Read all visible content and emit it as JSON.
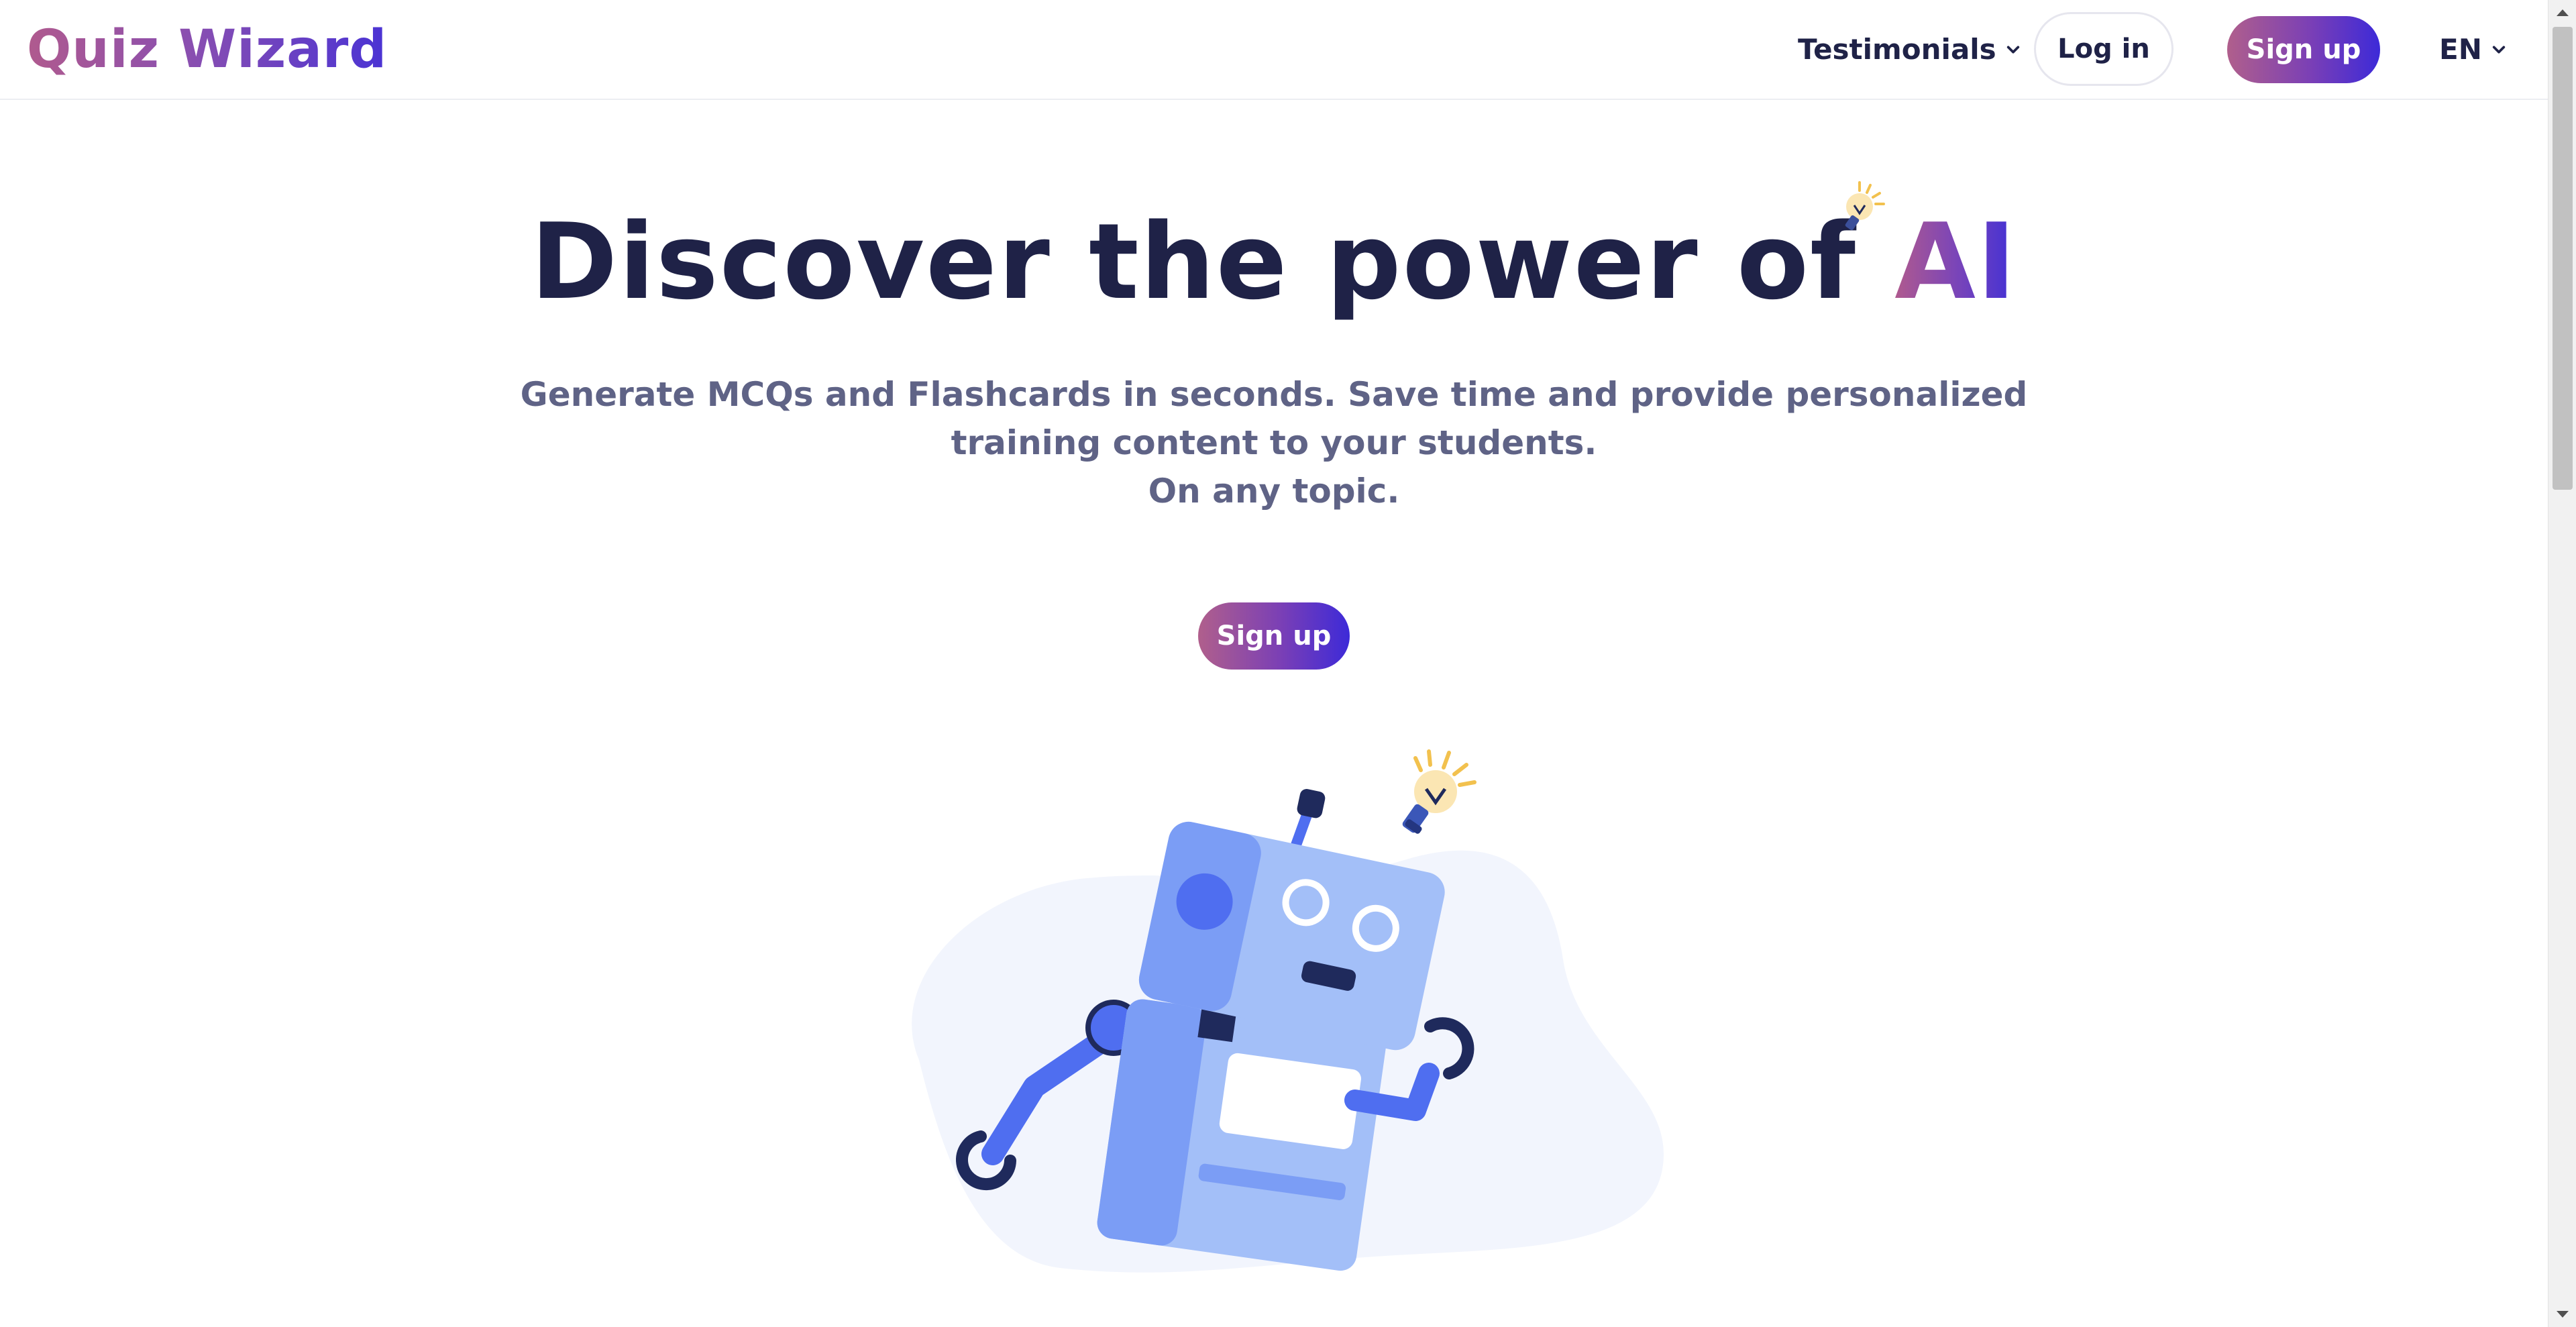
{
  "header": {
    "logo": "Quiz Wizard",
    "nav": {
      "testimonials_label": "Testimonials",
      "login_label": "Log in",
      "signup_label": "Sign up",
      "language_label": "EN"
    }
  },
  "hero": {
    "title_main": "Discover the power of ",
    "title_accent": "AI",
    "subtitle_line1": "Generate MCQs and Flashcards in seconds. Save time and provide personalized",
    "subtitle_line2": "training content to your students.",
    "subtitle_line3": "On any topic.",
    "cta_label": "Sign up"
  },
  "icons": {
    "testimonials_dropdown": "chevron-down-icon",
    "language_dropdown": "chevron-down-icon",
    "title_decoration": "lightbulb-icon",
    "illustration": "robot-illustration"
  },
  "colors": {
    "text_primary": "#1f2247",
    "text_secondary": "#5f6386",
    "gradient_start": "#b05f8c",
    "gradient_end": "#3d2ad8",
    "robot_body": "#a3bff8",
    "robot_accent": "#4f6ef0"
  }
}
